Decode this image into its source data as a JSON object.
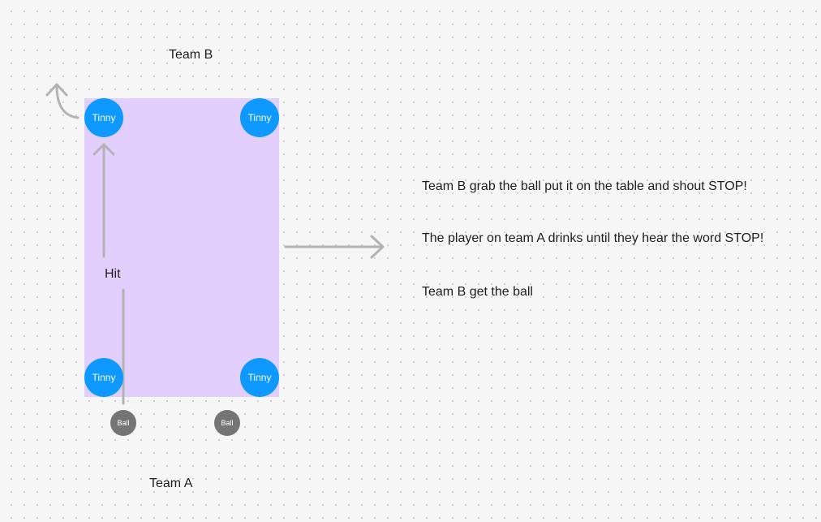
{
  "canvas": {
    "team_b_label": "Team B",
    "team_a_label": "Team A",
    "hit_label": "Hit",
    "colors": {
      "background": "#f6f6f6",
      "dot_grid": "#cfcfcf",
      "table": "#e3cffd",
      "tinny": "#0d99ff",
      "ball": "#757575",
      "connector": "#b3b3b3",
      "text": "#1e1e1e"
    }
  },
  "tinnies": [
    {
      "label": "Tinny",
      "position": "top-left"
    },
    {
      "label": "Tinny",
      "position": "top-right"
    },
    {
      "label": "Tinny",
      "position": "bottom-left"
    },
    {
      "label": "Tinny",
      "position": "bottom-right"
    }
  ],
  "balls": [
    {
      "label": "Ball"
    },
    {
      "label": "Ball"
    }
  ],
  "instructions": [
    "Team B grab the ball put it on the table and shout STOP!",
    "The player on team A drinks until they hear the word STOP!",
    "Team B get the ball"
  ]
}
